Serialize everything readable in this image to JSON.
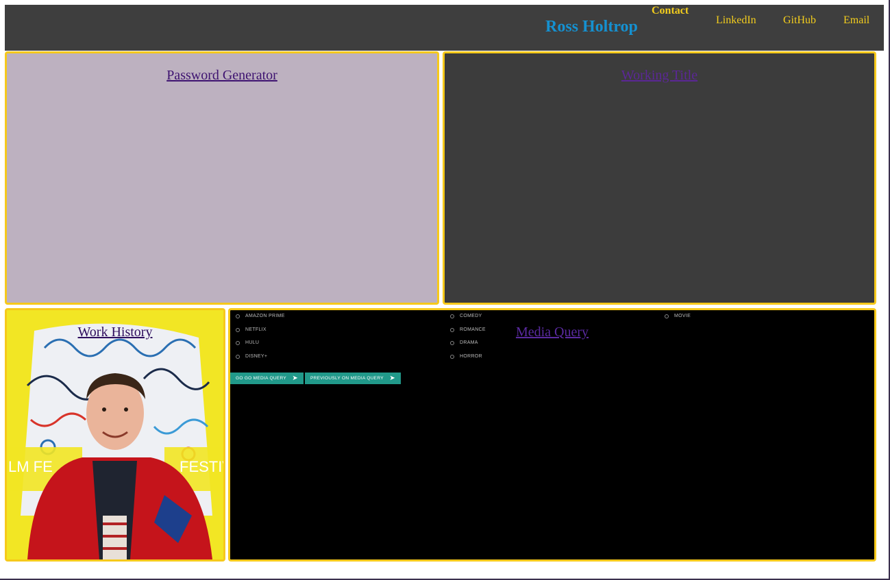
{
  "header": {
    "brand": "Ross Holtrop",
    "contact_heading": "Contact",
    "links": [
      "LinkedIn",
      "GitHub",
      "Email"
    ]
  },
  "cards": {
    "password_generator": "Password Generator",
    "working_title": "Working Title",
    "work_history": "Work History",
    "media_query": "Media Query"
  },
  "media_query_preview": {
    "services": [
      "AMAZON PRIME",
      "NETFLIX",
      "HULU",
      "DISNEY+"
    ],
    "genres": [
      "COMEDY",
      "ROMANCE",
      "DRAMA",
      "HORROR"
    ],
    "types": [
      "MOVIE"
    ],
    "buttons": [
      "GO GO MEDIA QUERY",
      "PREVIOUSLY ON MEDIA QUERY"
    ]
  },
  "colors": {
    "header_bg": "#3e3e3e",
    "brand": "#1591d1",
    "accent": "#f3cd1d",
    "card_border": "#f6c91b",
    "password_card_bg": "#bdb1c0",
    "working_title_bg": "#3c3c3c",
    "media_query_bg": "#000000",
    "mq_button": "#21998a"
  }
}
